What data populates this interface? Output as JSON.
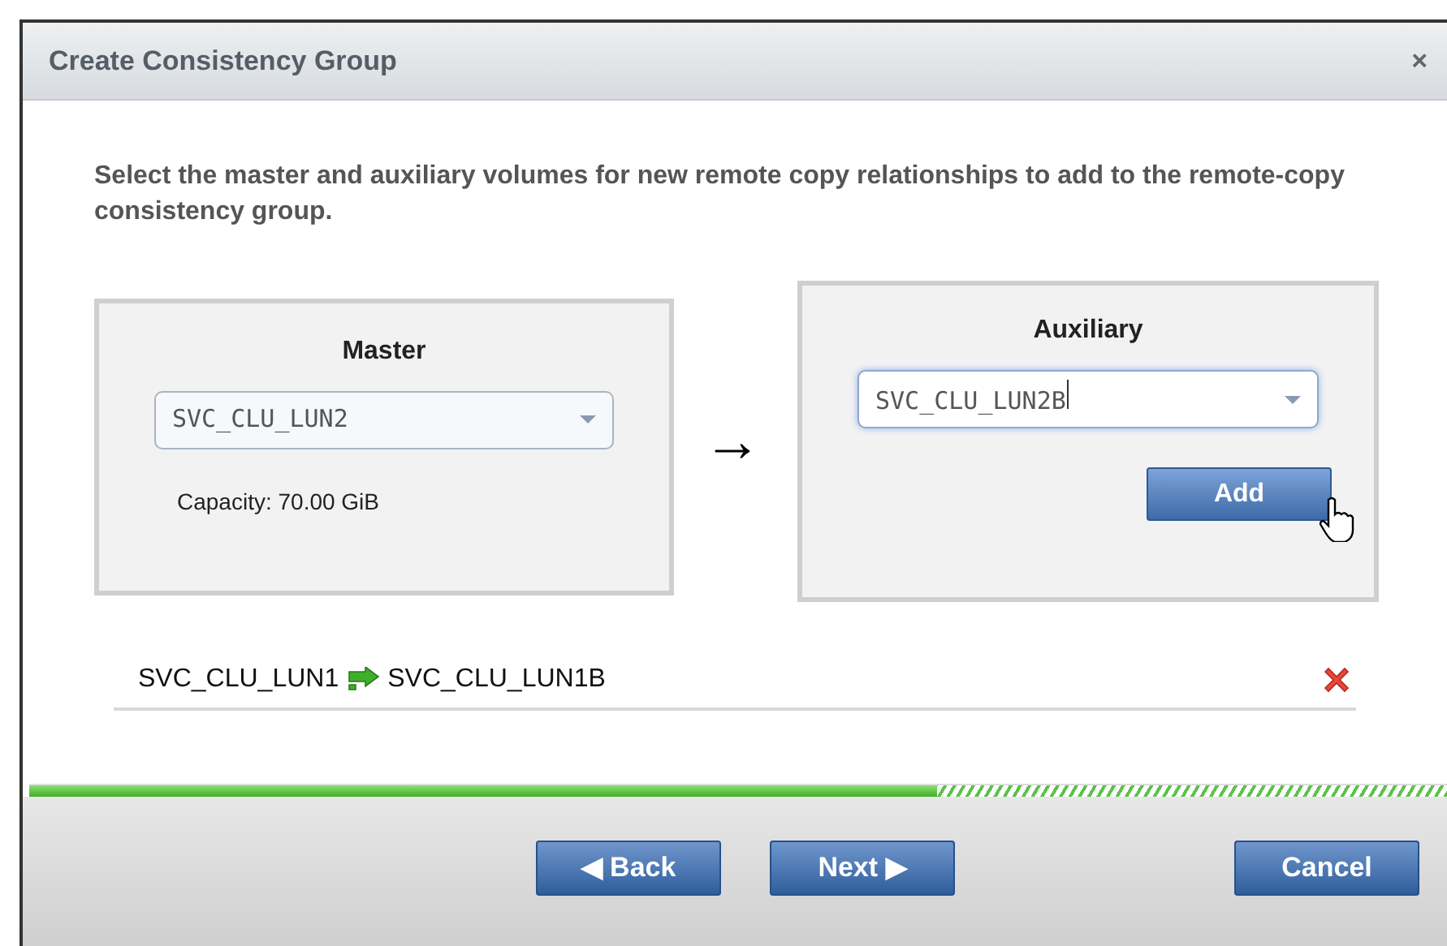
{
  "dialog": {
    "title": "Create Consistency Group",
    "close": "×"
  },
  "instructions": "Select the master and auxiliary volumes for new remote copy relationships to add to the remote-copy consistency group.",
  "master": {
    "heading": "Master",
    "volume": "SVC_CLU_LUN2",
    "capacity": "Capacity: 70.00 GiB"
  },
  "arrow": "→",
  "auxiliary": {
    "heading": "Auxiliary",
    "volume": "SVC_CLU_LUN2B",
    "add_button": "Add"
  },
  "relationships": [
    {
      "master": "SVC_CLU_LUN1",
      "auxiliary": "SVC_CLU_LUN1B"
    }
  ],
  "progress": {
    "level": 0.64
  },
  "buttons": [
    {
      "label": "◀ Back",
      "kind": "nav"
    },
    {
      "label": "Next ▶",
      "kind": "nav"
    },
    {
      "label": "Cancel",
      "kind": "cancel"
    }
  ]
}
